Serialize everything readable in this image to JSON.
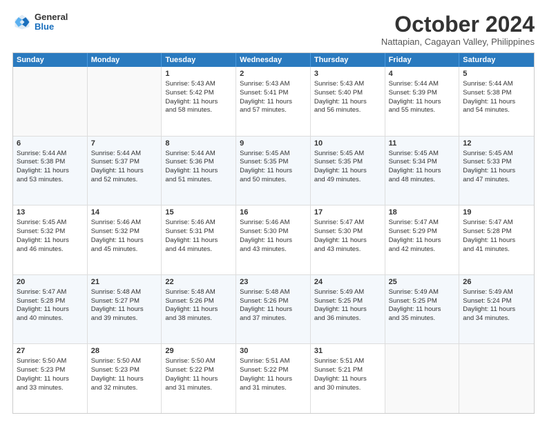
{
  "logo": {
    "general": "General",
    "blue": "Blue"
  },
  "title": "October 2024",
  "subtitle": "Nattapian, Cagayan Valley, Philippines",
  "headers": [
    "Sunday",
    "Monday",
    "Tuesday",
    "Wednesday",
    "Thursday",
    "Friday",
    "Saturday"
  ],
  "rows": [
    [
      {
        "day": "",
        "lines": []
      },
      {
        "day": "",
        "lines": []
      },
      {
        "day": "1",
        "lines": [
          "Sunrise: 5:43 AM",
          "Sunset: 5:42 PM",
          "Daylight: 11 hours",
          "and 58 minutes."
        ]
      },
      {
        "day": "2",
        "lines": [
          "Sunrise: 5:43 AM",
          "Sunset: 5:41 PM",
          "Daylight: 11 hours",
          "and 57 minutes."
        ]
      },
      {
        "day": "3",
        "lines": [
          "Sunrise: 5:43 AM",
          "Sunset: 5:40 PM",
          "Daylight: 11 hours",
          "and 56 minutes."
        ]
      },
      {
        "day": "4",
        "lines": [
          "Sunrise: 5:44 AM",
          "Sunset: 5:39 PM",
          "Daylight: 11 hours",
          "and 55 minutes."
        ]
      },
      {
        "day": "5",
        "lines": [
          "Sunrise: 5:44 AM",
          "Sunset: 5:38 PM",
          "Daylight: 11 hours",
          "and 54 minutes."
        ]
      }
    ],
    [
      {
        "day": "6",
        "lines": [
          "Sunrise: 5:44 AM",
          "Sunset: 5:38 PM",
          "Daylight: 11 hours",
          "and 53 minutes."
        ]
      },
      {
        "day": "7",
        "lines": [
          "Sunrise: 5:44 AM",
          "Sunset: 5:37 PM",
          "Daylight: 11 hours",
          "and 52 minutes."
        ]
      },
      {
        "day": "8",
        "lines": [
          "Sunrise: 5:44 AM",
          "Sunset: 5:36 PM",
          "Daylight: 11 hours",
          "and 51 minutes."
        ]
      },
      {
        "day": "9",
        "lines": [
          "Sunrise: 5:45 AM",
          "Sunset: 5:35 PM",
          "Daylight: 11 hours",
          "and 50 minutes."
        ]
      },
      {
        "day": "10",
        "lines": [
          "Sunrise: 5:45 AM",
          "Sunset: 5:35 PM",
          "Daylight: 11 hours",
          "and 49 minutes."
        ]
      },
      {
        "day": "11",
        "lines": [
          "Sunrise: 5:45 AM",
          "Sunset: 5:34 PM",
          "Daylight: 11 hours",
          "and 48 minutes."
        ]
      },
      {
        "day": "12",
        "lines": [
          "Sunrise: 5:45 AM",
          "Sunset: 5:33 PM",
          "Daylight: 11 hours",
          "and 47 minutes."
        ]
      }
    ],
    [
      {
        "day": "13",
        "lines": [
          "Sunrise: 5:45 AM",
          "Sunset: 5:32 PM",
          "Daylight: 11 hours",
          "and 46 minutes."
        ]
      },
      {
        "day": "14",
        "lines": [
          "Sunrise: 5:46 AM",
          "Sunset: 5:32 PM",
          "Daylight: 11 hours",
          "and 45 minutes."
        ]
      },
      {
        "day": "15",
        "lines": [
          "Sunrise: 5:46 AM",
          "Sunset: 5:31 PM",
          "Daylight: 11 hours",
          "and 44 minutes."
        ]
      },
      {
        "day": "16",
        "lines": [
          "Sunrise: 5:46 AM",
          "Sunset: 5:30 PM",
          "Daylight: 11 hours",
          "and 43 minutes."
        ]
      },
      {
        "day": "17",
        "lines": [
          "Sunrise: 5:47 AM",
          "Sunset: 5:30 PM",
          "Daylight: 11 hours",
          "and 43 minutes."
        ]
      },
      {
        "day": "18",
        "lines": [
          "Sunrise: 5:47 AM",
          "Sunset: 5:29 PM",
          "Daylight: 11 hours",
          "and 42 minutes."
        ]
      },
      {
        "day": "19",
        "lines": [
          "Sunrise: 5:47 AM",
          "Sunset: 5:28 PM",
          "Daylight: 11 hours",
          "and 41 minutes."
        ]
      }
    ],
    [
      {
        "day": "20",
        "lines": [
          "Sunrise: 5:47 AM",
          "Sunset: 5:28 PM",
          "Daylight: 11 hours",
          "and 40 minutes."
        ]
      },
      {
        "day": "21",
        "lines": [
          "Sunrise: 5:48 AM",
          "Sunset: 5:27 PM",
          "Daylight: 11 hours",
          "and 39 minutes."
        ]
      },
      {
        "day": "22",
        "lines": [
          "Sunrise: 5:48 AM",
          "Sunset: 5:26 PM",
          "Daylight: 11 hours",
          "and 38 minutes."
        ]
      },
      {
        "day": "23",
        "lines": [
          "Sunrise: 5:48 AM",
          "Sunset: 5:26 PM",
          "Daylight: 11 hours",
          "and 37 minutes."
        ]
      },
      {
        "day": "24",
        "lines": [
          "Sunrise: 5:49 AM",
          "Sunset: 5:25 PM",
          "Daylight: 11 hours",
          "and 36 minutes."
        ]
      },
      {
        "day": "25",
        "lines": [
          "Sunrise: 5:49 AM",
          "Sunset: 5:25 PM",
          "Daylight: 11 hours",
          "and 35 minutes."
        ]
      },
      {
        "day": "26",
        "lines": [
          "Sunrise: 5:49 AM",
          "Sunset: 5:24 PM",
          "Daylight: 11 hours",
          "and 34 minutes."
        ]
      }
    ],
    [
      {
        "day": "27",
        "lines": [
          "Sunrise: 5:50 AM",
          "Sunset: 5:23 PM",
          "Daylight: 11 hours",
          "and 33 minutes."
        ]
      },
      {
        "day": "28",
        "lines": [
          "Sunrise: 5:50 AM",
          "Sunset: 5:23 PM",
          "Daylight: 11 hours",
          "and 32 minutes."
        ]
      },
      {
        "day": "29",
        "lines": [
          "Sunrise: 5:50 AM",
          "Sunset: 5:22 PM",
          "Daylight: 11 hours",
          "and 31 minutes."
        ]
      },
      {
        "day": "30",
        "lines": [
          "Sunrise: 5:51 AM",
          "Sunset: 5:22 PM",
          "Daylight: 11 hours",
          "and 31 minutes."
        ]
      },
      {
        "day": "31",
        "lines": [
          "Sunrise: 5:51 AM",
          "Sunset: 5:21 PM",
          "Daylight: 11 hours",
          "and 30 minutes."
        ]
      },
      {
        "day": "",
        "lines": []
      },
      {
        "day": "",
        "lines": []
      }
    ]
  ]
}
